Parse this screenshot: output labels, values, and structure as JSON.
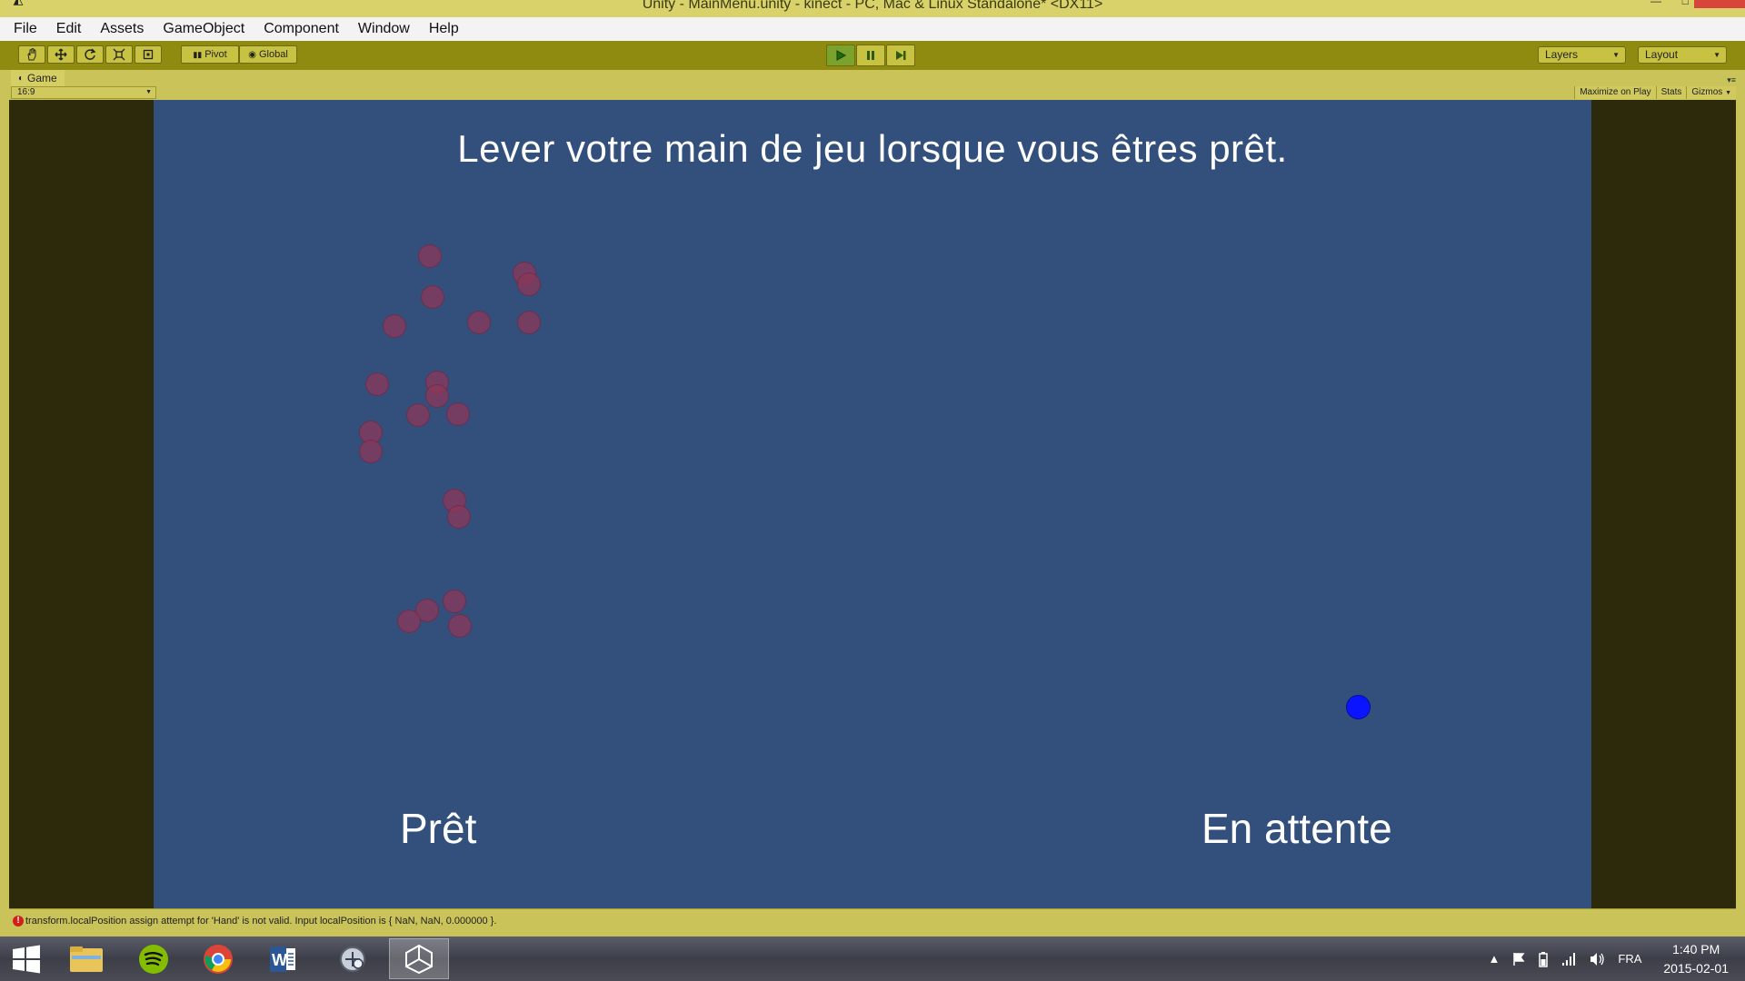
{
  "window": {
    "title": "Unity - MainMenu.unity - kinect - PC, Mac & Linux Standalone* <DX11>"
  },
  "menubar": {
    "items": [
      "File",
      "Edit",
      "Assets",
      "GameObject",
      "Component",
      "Window",
      "Help"
    ]
  },
  "toolbar": {
    "pivot_label": "Pivot",
    "global_label": "Global",
    "layers_label": "Layers",
    "layout_label": "Layout",
    "tools": [
      "hand-tool-icon",
      "move-tool-icon",
      "rotate-tool-icon",
      "scale-tool-icon",
      "rect-tool-icon"
    ]
  },
  "game_view": {
    "tab_label": "Game",
    "aspect_label": "16:9",
    "maximize_label": "Maximize on Play",
    "stats_label": "Stats",
    "gizmos_label": "Gizmos",
    "headline": "Lever votre main de jeu lorsque vous êtres prêt.",
    "ready_label": "Prêt",
    "waiting_label": "En attente",
    "colors": {
      "background": "#33507c",
      "joint_dots": "#8c375a",
      "hand_cursor": "#0a14ff"
    }
  },
  "console": {
    "message": "transform.localPosition assign attempt for 'Hand' is not valid. Input localPosition is { NaN, NaN, 0.000000 }."
  },
  "taskbar": {
    "apps": [
      "windows-start-icon",
      "file-explorer-icon",
      "spotify-icon",
      "chrome-icon",
      "word-icon",
      "remote-app-icon",
      "unity-icon"
    ],
    "language": "FRA",
    "time": "1:40 PM",
    "date": "2015-02-01"
  }
}
